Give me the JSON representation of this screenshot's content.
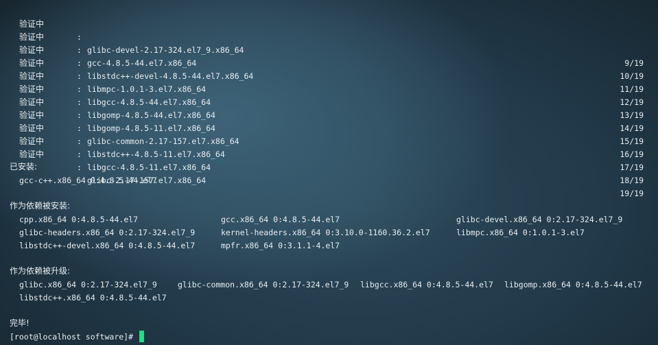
{
  "verify_rows": [
    {
      "label": "验证中",
      "package": "glibc-devel-2.17-324.el7_9.x86_64",
      "count": "9/19"
    },
    {
      "label": "验证中",
      "package": "gcc-4.8.5-44.el7.x86_64",
      "count": "10/19"
    },
    {
      "label": "验证中",
      "package": "libstdc++-devel-4.8.5-44.el7.x86_64",
      "count": "11/19"
    },
    {
      "label": "验证中",
      "package": "libmpc-1.0.1-3.el7.x86_64",
      "count": "12/19"
    },
    {
      "label": "验证中",
      "package": "libgcc-4.8.5-44.el7.x86_64",
      "count": "13/19"
    },
    {
      "label": "验证中",
      "package": "libgomp-4.8.5-44.el7.x86_64",
      "count": "14/19"
    },
    {
      "label": "验证中",
      "package": "libgomp-4.8.5-11.el7.x86_64",
      "count": "15/19"
    },
    {
      "label": "验证中",
      "package": "glibc-common-2.17-157.el7.x86_64",
      "count": "16/19"
    },
    {
      "label": "验证中",
      "package": "libstdc++-4.8.5-11.el7.x86_64",
      "count": "17/19"
    },
    {
      "label": "验证中",
      "package": "libgcc-4.8.5-11.el7.x86_64",
      "count": "18/19"
    },
    {
      "label": "验证中",
      "package": "glibc-2.17-157.el7.x86_64",
      "count": "19/19"
    }
  ],
  "colon": ":",
  "installed": {
    "heading": "已安装:",
    "items": [
      "gcc-c++.x86_64 0:4.8.5-44.el7"
    ]
  },
  "dependency_installed": {
    "heading": "作为依赖被安装:",
    "items": [
      "cpp.x86_64 0:4.8.5-44.el7",
      "gcc.x86_64 0:4.8.5-44.el7",
      "glibc-devel.x86_64 0:2.17-324.el7_9",
      "glibc-headers.x86_64 0:2.17-324.el7_9",
      "kernel-headers.x86_64 0:3.10.0-1160.36.2.el7",
      "libmpc.x86_64 0:1.0.1-3.el7",
      "libstdc++-devel.x86_64 0:4.8.5-44.el7",
      "mpfr.x86_64 0:3.1.1-4.el7"
    ]
  },
  "dependency_updated": {
    "heading": "作为依赖被升级:",
    "items": [
      "glibc.x86_64 0:2.17-324.el7_9",
      "glibc-common.x86_64 0:2.17-324.el7_9",
      "libgcc.x86_64 0:4.8.5-44.el7",
      "libgomp.x86_64 0:4.8.5-44.el7",
      "libstdc++.x86_64 0:4.8.5-44.el7"
    ]
  },
  "complete": "完毕!",
  "prompt": "[root@localhost software]# ",
  "colors": {
    "text": "#e7ecef",
    "cursor": "#18e27a"
  }
}
